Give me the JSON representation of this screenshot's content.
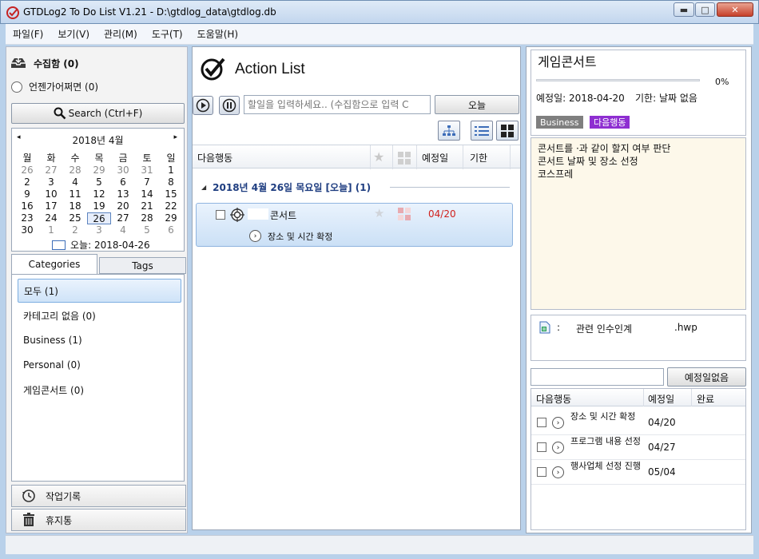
{
  "window": {
    "title": "GTDLog2 To Do List V1.21 - D:\\gtdlog_data\\gtdlog.db",
    "minimize": "▬",
    "maximize": "□",
    "close": "✕"
  },
  "menu": [
    "파일(F)",
    "보기(V)",
    "관리(M)",
    "도구(T)",
    "도움말(H)"
  ],
  "sidebar": {
    "inbox_label": "수집함 (0)",
    "someday_label": "언젠가어쩌면 (0)",
    "search_label": "Search (Ctrl+F)",
    "calendar": {
      "month_label": "2018년 4월",
      "prev": "◂",
      "next": "▸",
      "weekdays": [
        "월",
        "화",
        "수",
        "목",
        "금",
        "토",
        "일"
      ],
      "weeks": [
        [
          "26",
          "27",
          "28",
          "29",
          "30",
          "31",
          "1"
        ],
        [
          "2",
          "3",
          "4",
          "5",
          "6",
          "7",
          "8"
        ],
        [
          "9",
          "10",
          "11",
          "12",
          "13",
          "14",
          "15"
        ],
        [
          "16",
          "17",
          "18",
          "19",
          "20",
          "21",
          "22"
        ],
        [
          "23",
          "24",
          "25",
          "26",
          "27",
          "28",
          "29"
        ],
        [
          "30",
          "1",
          "2",
          "3",
          "4",
          "5",
          "6"
        ]
      ],
      "today_label": "오늘: 2018-04-26"
    },
    "tabs": [
      "Categories",
      "Tags"
    ],
    "categories": [
      "모두 (1)",
      "카테고리 없음 (0)",
      "Business (1)",
      "Personal (0)",
      "게임콘서트 (0)"
    ],
    "work_log_label": "작업기록",
    "trash_label": "휴지통"
  },
  "center": {
    "title": "Action List",
    "input_placeholder": "할일을 입력하세요.. (수집함으로 입력 C",
    "today_button": "오늘",
    "columns": {
      "next_action": "다음행동",
      "scheduled": "예정일",
      "due": "기한"
    },
    "group_label": "2018년 4월 26일 목요일 [오늘] (1)",
    "task": {
      "title": "콘서트",
      "date": "04/20",
      "next_step": "장소 및 시간 확정"
    }
  },
  "detail": {
    "title": "게임콘서트",
    "progress_percent": 0,
    "progress_label": "0%",
    "scheduled_label": "예정일: 2018-04-20",
    "due_label": "기한: 날짜 없음",
    "tags": [
      {
        "label": "Business",
        "color": "#7f7f7f"
      },
      {
        "label": "다음행동",
        "color": "#8e2ed1"
      }
    ],
    "notes": [
      "콘서트를 ·과 같이 할지 여부 판단",
      "콘서트 날짜 및 장소 선정",
      "코스프레"
    ],
    "attachment_sep": ":",
    "attachment_text": "관련 인수인계",
    "attachment_ext": ".hwp",
    "no_due_button": "예정일없음",
    "next_columns": {
      "action": "다음행동",
      "scheduled": "예정일",
      "done": "완료"
    },
    "next_actions": [
      {
        "action": "장소 및 시간 확정",
        "date": "04/20"
      },
      {
        "action": "프로그램 내용 선정",
        "date": "04/27"
      },
      {
        "action": "행사업체 선정 진행",
        "date": "05/04"
      }
    ]
  },
  "colors": {
    "accent": "#3c6db8",
    "date_red": "#d0201c",
    "group_blue": "#1e3d80"
  }
}
